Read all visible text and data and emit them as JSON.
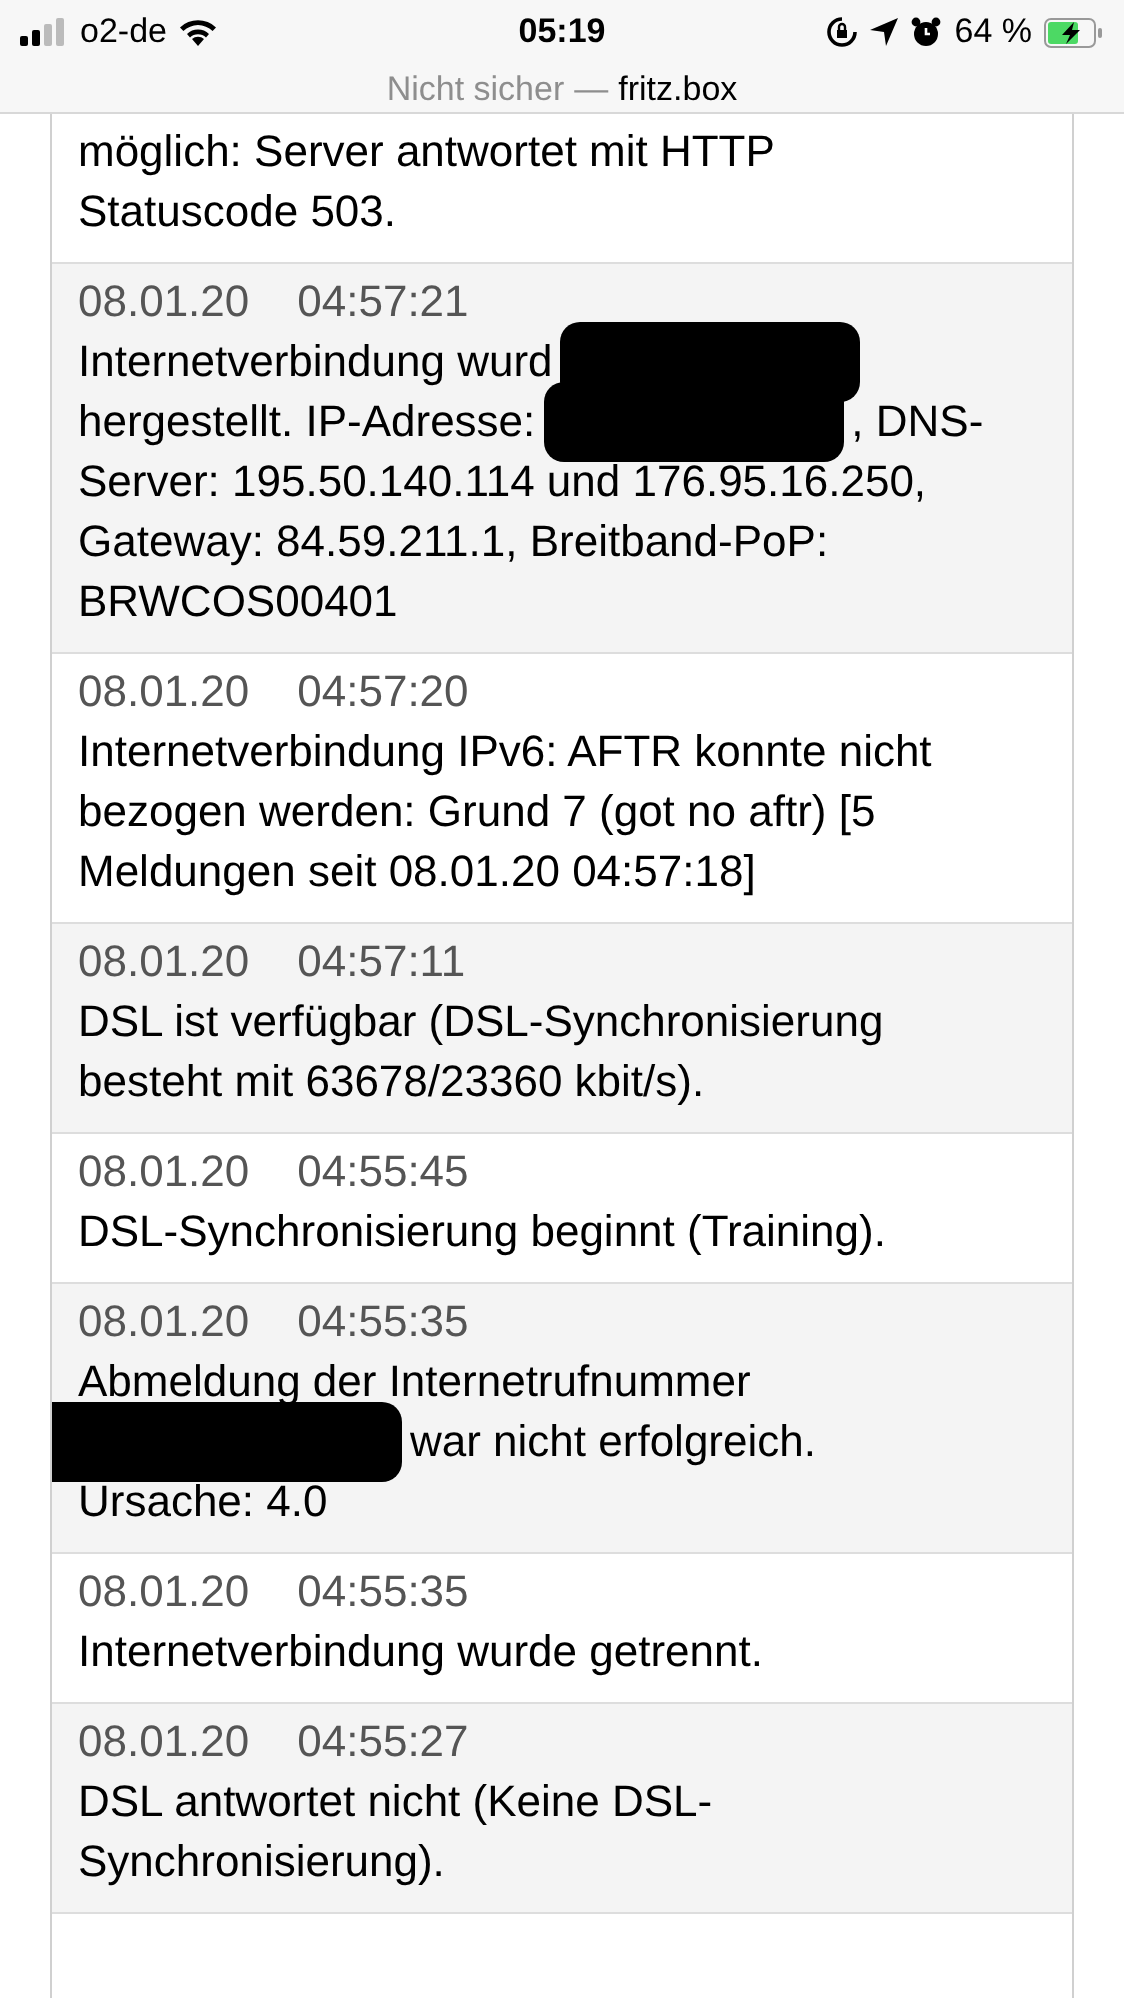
{
  "status_bar": {
    "carrier": "o2-de",
    "time": "05:19",
    "battery_percent": "64 %"
  },
  "address_bar": {
    "security": "Nicht sicher",
    "separator": "—",
    "host": "fritz.box"
  },
  "events": [
    {
      "lines": [
        [
          {
            "kind": "text",
            "text": "möglich: Server antwortet mit HTTP"
          }
        ],
        [
          {
            "kind": "text",
            "text": "Statuscode 503."
          }
        ]
      ]
    },
    {
      "date": "08.01.20",
      "time": "04:57:21",
      "lines": [
        [
          {
            "kind": "text",
            "text": "Internetverbindung wurd"
          },
          {
            "kind": "redaction"
          }
        ],
        [
          {
            "kind": "text",
            "text": "hergestellt. IP-Adresse:"
          },
          {
            "kind": "redaction"
          },
          {
            "kind": "text",
            "text": ", DNS-"
          }
        ],
        [
          {
            "kind": "text",
            "text": "Server: 195.50.140.114 und 176.95.16.250,"
          }
        ],
        [
          {
            "kind": "text",
            "text": "Gateway: 84.59.211.1, Breitband-PoP:"
          }
        ],
        [
          {
            "kind": "text",
            "text": "BRWCOS00401"
          }
        ]
      ]
    },
    {
      "date": "08.01.20",
      "time": "04:57:20",
      "lines": [
        [
          {
            "kind": "text",
            "text": "Internetverbindung IPv6: AFTR konnte nicht"
          }
        ],
        [
          {
            "kind": "text",
            "text": "bezogen werden: Grund 7 (got no aftr) [5"
          }
        ],
        [
          {
            "kind": "text",
            "text": "Meldungen seit 08.01.20 04:57:18]"
          }
        ]
      ]
    },
    {
      "date": "08.01.20",
      "time": "04:57:11",
      "lines": [
        [
          {
            "kind": "text",
            "text": "DSL ist verfügbar (DSL-Synchronisierung"
          }
        ],
        [
          {
            "kind": "text",
            "text": "besteht mit 63678/23360 kbit/s)."
          }
        ]
      ]
    },
    {
      "date": "08.01.20",
      "time": "04:55:45",
      "lines": [
        [
          {
            "kind": "text",
            "text": "DSL-Synchronisierung beginnt (Training)."
          }
        ]
      ]
    },
    {
      "date": "08.01.20",
      "time": "04:55:35",
      "lines": [
        [
          {
            "kind": "text",
            "text": "Abmeldung der Internetrufnummer"
          }
        ],
        [
          {
            "kind": "redaction"
          },
          {
            "kind": "text",
            "text": "war nicht erfolgreich."
          }
        ],
        [
          {
            "kind": "text",
            "text": "Ursache: 4.0"
          }
        ]
      ]
    },
    {
      "date": "08.01.20",
      "time": "04:55:35",
      "lines": [
        [
          {
            "kind": "text",
            "text": "Internetverbindung wurde getrennt."
          }
        ]
      ]
    },
    {
      "date": "08.01.20",
      "time": "04:55:27",
      "lines": [
        [
          {
            "kind": "text",
            "text": "DSL antwortet nicht (Keine DSL-"
          }
        ],
        [
          {
            "kind": "text",
            "text": "Synchronisierung)."
          }
        ]
      ]
    }
  ]
}
